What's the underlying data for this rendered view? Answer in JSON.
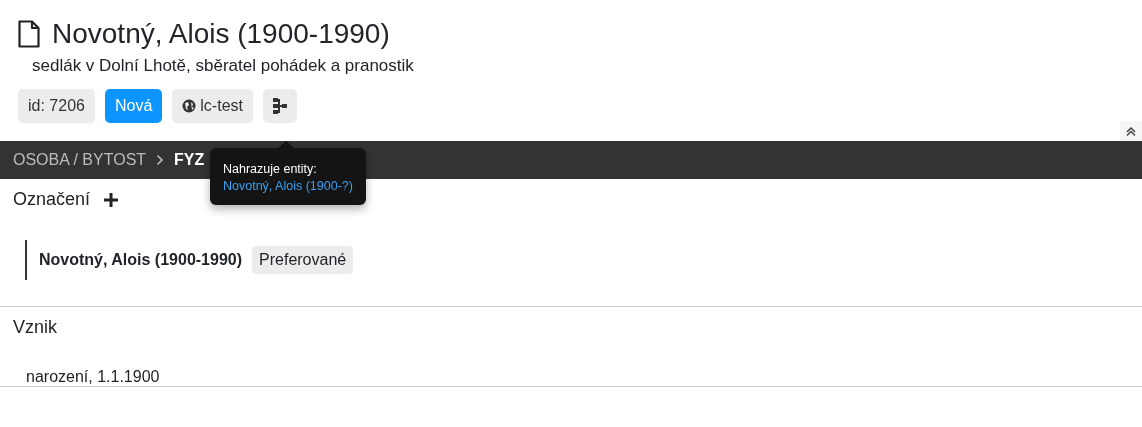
{
  "title": "Novotný, Alois (1900-1990)",
  "subtitle": "sedlák v Dolní Lhotě, sběratel pohádek a pranostik",
  "badges": [
    {
      "kind": "plain",
      "label": "id: 7206"
    },
    {
      "kind": "primary",
      "label": "Nová"
    },
    {
      "kind": "globe",
      "label": "lc-test"
    },
    {
      "kind": "tree"
    }
  ],
  "breadcrumb": [
    "OSOBA / BYTOST",
    "FYZ"
  ],
  "tooltip": {
    "title": "Nahrazuje entity:",
    "link": "Novotný, Alois (1900-?)"
  },
  "sections": [
    {
      "title": "Označení",
      "addable": true,
      "items": [
        {
          "kind": "name",
          "text": "Novotný, Alois (1900-1990)",
          "tag": "Preferované"
        }
      ]
    },
    {
      "title": "Vznik",
      "addable": false,
      "items": [
        {
          "kind": "event",
          "text": "narození, 1.1.1900"
        }
      ]
    }
  ]
}
